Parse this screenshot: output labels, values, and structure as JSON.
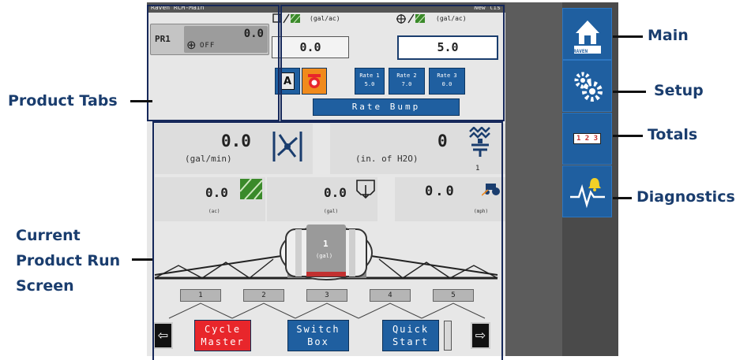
{
  "screen": {
    "title_left": "Raven RCM-Main",
    "title_right": "New lis"
  },
  "product_tab": {
    "label": "PR1",
    "value": "0.0",
    "status": "OFF"
  },
  "rate_header": {
    "actual_unit": "(gal/ac)",
    "target_unit": "(gal/ac)"
  },
  "rates": {
    "actual_rate": "0.0",
    "target_rate": "5.0"
  },
  "rate_presets": [
    {
      "label": "Rate 1",
      "value": "5.0"
    },
    {
      "label": "Rate 2",
      "value": "7.0"
    },
    {
      "label": "Rate 3",
      "value": "0.0"
    }
  ],
  "rate_bump_label": "Rate Bump",
  "flow": {
    "value": "0.0",
    "unit": "(gal/min)"
  },
  "pressure": {
    "value": "0",
    "unit": "(in. of H2O)",
    "sensor": "1"
  },
  "area": {
    "value": "0.0",
    "unit": "(ac)"
  },
  "volume": {
    "value": "0.0",
    "unit": "(gal)"
  },
  "speed": {
    "value": "0.0",
    "unit": "(mph)"
  },
  "tank": {
    "number": "1",
    "unit": "(gal)"
  },
  "sections": [
    "1",
    "2",
    "3",
    "4",
    "5"
  ],
  "bottom_buttons": {
    "cycle_master": "Cycle Master",
    "switch_box": "Switch Box",
    "quick_start": "Quick Start"
  },
  "nav": {
    "main_badge": "RAVEN",
    "totals_badge": "1 2 3"
  },
  "callouts": {
    "product_tabs": "Product Tabs",
    "current_run_1": "Current",
    "current_run_2": "Product Run",
    "current_run_3": "Screen",
    "main": "Main",
    "setup": "Setup",
    "totals": "Totals",
    "diagnostics": "Diagnostics"
  },
  "colors": {
    "button_blue": "#1f5fa0",
    "cycle_red": "#e8262b",
    "orange": "#f08a1c",
    "callout_navy": "#1a3d6e"
  }
}
